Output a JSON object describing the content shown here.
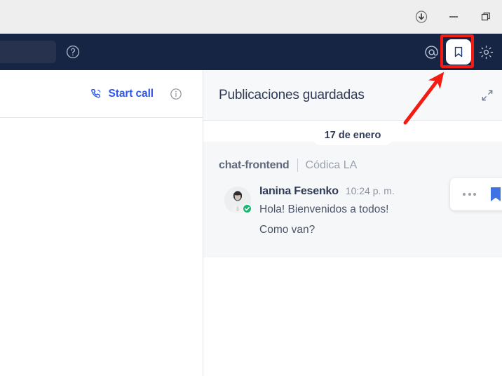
{
  "titlebar": {
    "download_icon": "download-circle-icon",
    "minimize_icon": "minimize-icon",
    "maximize_icon": "maximize-restore-icon"
  },
  "navbar": {
    "background_color": "#172544",
    "search_placeholder": "",
    "search_value": "",
    "help_icon": "help-circle-icon",
    "mentions_icon": "mention-at-icon",
    "saved_icon": "bookmark-icon",
    "settings_icon": "gear-icon",
    "active_item": "saved",
    "annotation_color": "#f51b13"
  },
  "chat_header": {
    "start_call_label": "Start call",
    "start_call_color": "#2f58e8",
    "phone_icon": "phone-call-icon",
    "info_icon": "info-circle-icon"
  },
  "saved_panel": {
    "title": "Publicaciones guardadas",
    "expand_icon": "expand-diagonal-icon",
    "date_divider": "17 de enero",
    "post": {
      "channel": "chat-frontend",
      "team": "Códica LA",
      "author": "Ianina Fesenko",
      "time": "10:24 p. m.",
      "text_line_1": "Hola! Bienvenidos a todos!",
      "text_line_2": "Como van?",
      "presence_status": "online",
      "presence_color": "#21b573",
      "actions": {
        "more_icon": "ellipsis-icon",
        "bookmark_icon": "bookmark-filled-icon",
        "bookmark_color": "#3f73e3"
      }
    }
  }
}
